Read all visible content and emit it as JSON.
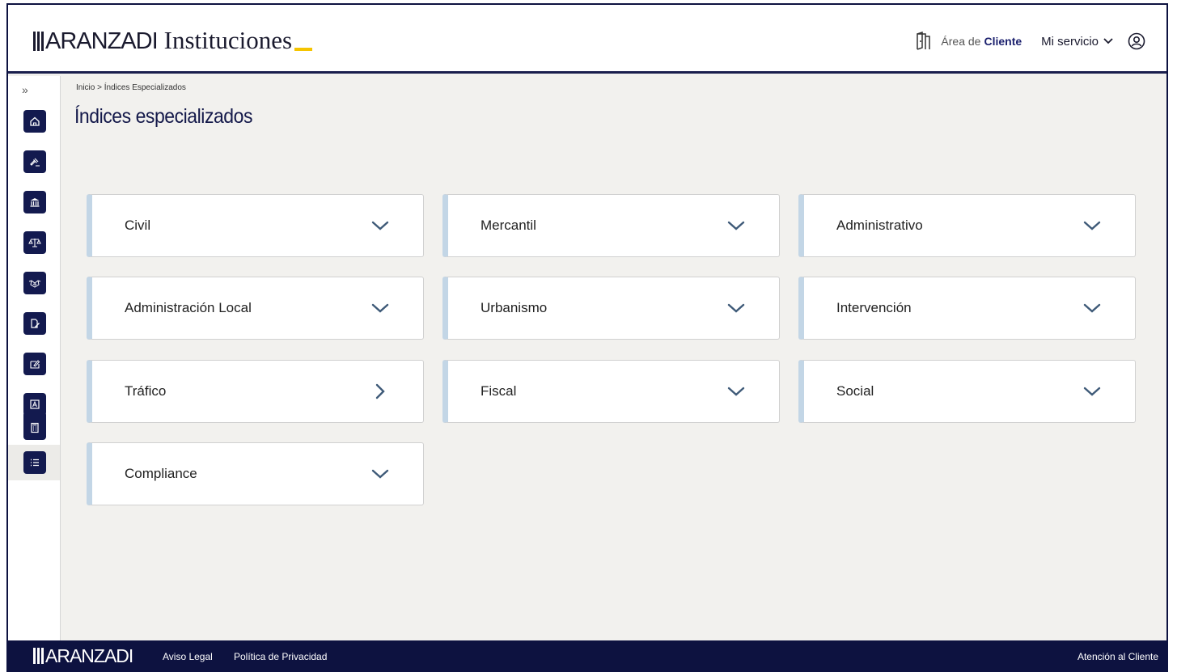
{
  "header": {
    "logo_mark": "ARANZADI",
    "logo_product": "Instituciones",
    "area_prefix": "Área de",
    "area_strong": "Cliente",
    "service_label": "Mi servicio"
  },
  "sidebar": {
    "expand_label": "»",
    "items": [
      {
        "icon": "home-icon"
      },
      {
        "icon": "gavel-icon"
      },
      {
        "icon": "institution-icon"
      },
      {
        "icon": "scales-icon"
      },
      {
        "icon": "handshake-icon"
      },
      {
        "icon": "document-edit-icon"
      },
      {
        "icon": "form-edit-icon"
      },
      {
        "icon": "text-box-icon"
      },
      {
        "icon": "calculator-icon"
      },
      {
        "icon": "list-icon",
        "active": true
      }
    ]
  },
  "breadcrumb": "Inicio > Índices Especializados",
  "page_title": "Índices especializados",
  "categories": [
    {
      "label": "Civil",
      "chevron": "down"
    },
    {
      "label": "Mercantil",
      "chevron": "down"
    },
    {
      "label": "Administrativo",
      "chevron": "down"
    },
    {
      "label": "Administración Local",
      "chevron": "down"
    },
    {
      "label": "Urbanismo",
      "chevron": "down"
    },
    {
      "label": "Intervención",
      "chevron": "down"
    },
    {
      "label": "Tráfico",
      "chevron": "right"
    },
    {
      "label": "Fiscal",
      "chevron": "down"
    },
    {
      "label": "Social",
      "chevron": "down"
    },
    {
      "label": "Compliance",
      "chevron": "down"
    }
  ],
  "footer": {
    "logo_mark": "ARANZADI",
    "aviso_legal": "Aviso Legal",
    "privacidad": "Política de Privacidad",
    "atencion": "Atención al Cliente"
  },
  "colors": {
    "navy": "#131a4f",
    "accent_yellow": "#f5c400",
    "card_accent": "#c3d6e6",
    "chevron": "#3e5a78"
  }
}
